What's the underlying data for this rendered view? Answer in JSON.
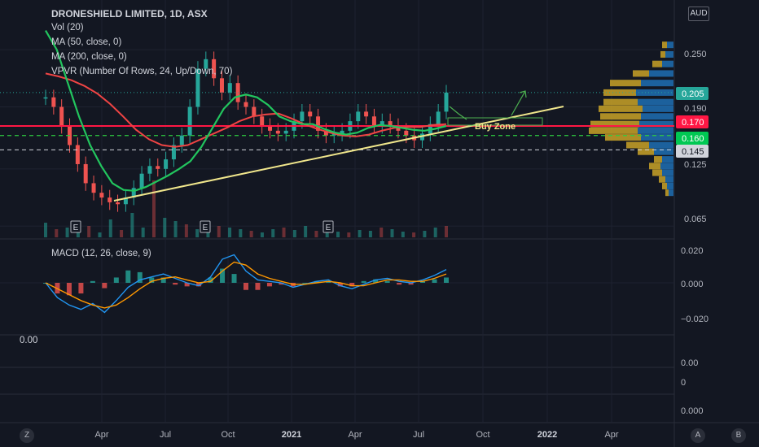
{
  "header": {
    "title": "DRONESHIELD LIMITED, 1D, ASX",
    "vol": "Vol (20)",
    "ma50": "MA (50, close, 0)",
    "ma200": "MA (200, close, 0)",
    "vpvr": "VPVR (Number Of Rows, 24, Up/Down, 70)",
    "currency": "AUD"
  },
  "macd_label": "MACD (12, 26, close, 9)",
  "left_scale_value": "0.00",
  "corner_buttons": {
    "left": "Z",
    "right_a": "A",
    "right_b": "B"
  },
  "annotation": {
    "buy_zone": "Buy Zone"
  },
  "colors": {
    "background": "#131722",
    "grid": "#1e2230",
    "up": "#26a69a",
    "down": "#ef5350",
    "ma50": "#22c55e",
    "ma200": "#ef4444",
    "trendline": "#f0e68c",
    "resistance": "#ff1744",
    "support_dash": "#2ecc40",
    "macd": "#2196f3",
    "signal": "#ff9800",
    "vp_up": "#1e6fb3",
    "vp_down": "#c9a227"
  },
  "chart_data": [
    {
      "type": "candlestick",
      "title": "DRONESHIELD LIMITED, 1D, ASX",
      "x_tick_labels": [
        "Apr",
        "Jul",
        "Oct",
        "2021",
        "Apr",
        "Jul",
        "Oct",
        "2022",
        "Apr"
      ],
      "y_tick_labels": [
        "0.250",
        "0.190",
        "0.125",
        "0.065"
      ],
      "price_labels": [
        {
          "value": "0.205",
          "color": "#26a69a"
        },
        {
          "value": "0.170",
          "color": "#ff1744"
        },
        {
          "value": "0.160",
          "color": "#00c853"
        },
        {
          "value": "0.145",
          "color": "#d1d4dc"
        }
      ],
      "ylim": [
        0.055,
        0.285
      ],
      "close_series": [
        0.2,
        0.19,
        0.17,
        0.15,
        0.13,
        0.11,
        0.1,
        0.095,
        0.09,
        0.088,
        0.095,
        0.105,
        0.12,
        0.128,
        0.125,
        0.135,
        0.15,
        0.16,
        0.19,
        0.23,
        0.24,
        0.22,
        0.205,
        0.215,
        0.195,
        0.19,
        0.18,
        0.17,
        0.165,
        0.162,
        0.165,
        0.175,
        0.185,
        0.18,
        0.165,
        0.16,
        0.162,
        0.165,
        0.175,
        0.185,
        0.18,
        0.17,
        0.175,
        0.17,
        0.165,
        0.16,
        0.155,
        0.162,
        0.172,
        0.185,
        0.205
      ],
      "ma50": [
        0.27,
        0.25,
        0.215,
        0.18,
        0.15,
        0.128,
        0.11,
        0.103,
        0.102,
        0.106,
        0.112,
        0.118,
        0.125,
        0.133,
        0.148,
        0.168,
        0.188,
        0.2,
        0.203,
        0.2,
        0.192,
        0.18,
        0.175,
        0.172,
        0.172,
        0.167,
        0.163,
        0.161,
        0.163,
        0.168,
        0.171,
        0.17,
        0.168,
        0.166,
        0.165,
        0.167,
        0.17
      ],
      "ma200": [
        0.225,
        0.222,
        0.218,
        0.212,
        0.204,
        0.193,
        0.18,
        0.166,
        0.156,
        0.15,
        0.148,
        0.15,
        0.156,
        0.162,
        0.168,
        0.175,
        0.18,
        0.182,
        0.183,
        0.178,
        0.172,
        0.167,
        0.163,
        0.16,
        0.159,
        0.161,
        0.165,
        0.168,
        0.169,
        0.169,
        0.171,
        0.172
      ],
      "volume": [
        18,
        10,
        12,
        8,
        14,
        6,
        22,
        9,
        30,
        12,
        70,
        24,
        20,
        16,
        10,
        8,
        14,
        12,
        10,
        8,
        6,
        10,
        12,
        9,
        14,
        8,
        10,
        7,
        6,
        9,
        8,
        12,
        10,
        7,
        6,
        8,
        12,
        14
      ],
      "earnings_markers": [
        "E",
        "E",
        "E"
      ],
      "volume_profile": [
        {
          "price": 0.255,
          "up": 8,
          "down": 6
        },
        {
          "price": 0.245,
          "up": 10,
          "down": 6
        },
        {
          "price": 0.235,
          "up": 14,
          "down": 12
        },
        {
          "price": 0.225,
          "up": 30,
          "down": 20
        },
        {
          "price": 0.215,
          "up": 40,
          "down": 38
        },
        {
          "price": 0.205,
          "up": 46,
          "down": 40
        },
        {
          "price": 0.195,
          "up": 44,
          "down": 42
        },
        {
          "price": 0.188,
          "up": 38,
          "down": 54
        },
        {
          "price": 0.18,
          "up": 40,
          "down": 50
        },
        {
          "price": 0.172,
          "up": 42,
          "down": 60
        },
        {
          "price": 0.165,
          "up": 44,
          "down": 60
        },
        {
          "price": 0.158,
          "up": 40,
          "down": 44
        },
        {
          "price": 0.15,
          "up": 30,
          "down": 28
        },
        {
          "price": 0.143,
          "up": 24,
          "down": 20
        },
        {
          "price": 0.135,
          "up": 14,
          "down": 10
        },
        {
          "price": 0.128,
          "up": 16,
          "down": 14
        },
        {
          "price": 0.121,
          "up": 14,
          "down": 12
        },
        {
          "price": 0.114,
          "up": 10,
          "down": 8
        },
        {
          "price": 0.107,
          "up": 8,
          "down": 6
        },
        {
          "price": 0.1,
          "up": 6,
          "down": 4
        }
      ]
    },
    {
      "type": "macd",
      "title": "MACD (12, 26, close, 9)",
      "y_tick_labels": [
        "0.020",
        "0.000",
        "−0.020"
      ],
      "ylim": [
        -0.026,
        0.022
      ],
      "macd": [
        0.0,
        -0.01,
        -0.015,
        -0.018,
        -0.014,
        -0.02,
        -0.012,
        -0.003,
        0.002,
        0.004,
        0.006,
        0.003,
        0.0,
        -0.002,
        0.004,
        0.016,
        0.019,
        0.008,
        0.002,
        0.001,
        0.0,
        -0.003,
        -0.001,
        0.001,
        0.002,
        -0.002,
        -0.004,
        -0.001,
        0.002,
        0.003,
        0.001,
        0.0,
        0.002,
        0.005,
        0.009
      ],
      "signal": [
        0.0,
        -0.004,
        -0.008,
        -0.012,
        -0.015,
        -0.017,
        -0.015,
        -0.01,
        -0.004,
        0.001,
        0.003,
        0.004,
        0.002,
        0.0,
        0.001,
        0.008,
        0.014,
        0.012,
        0.006,
        0.003,
        0.001,
        -0.001,
        -0.001,
        0.0,
        0.001,
        0.0,
        -0.002,
        -0.002,
        0.0,
        0.002,
        0.002,
        0.001,
        0.001,
        0.003,
        0.006
      ]
    },
    {
      "type": "line",
      "title": "",
      "y_tick_labels": [
        "0.00",
        "0",
        "0.000"
      ]
    }
  ]
}
